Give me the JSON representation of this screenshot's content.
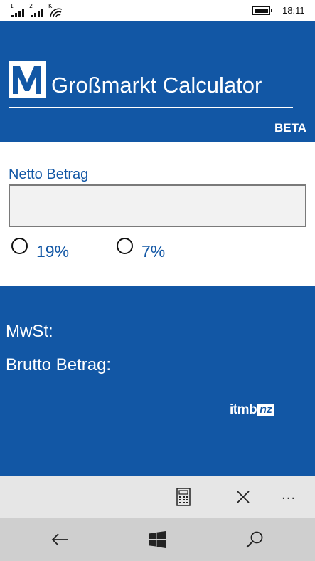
{
  "status_bar": {
    "sim1": "1",
    "sim2": "2",
    "wifi_marker": "K",
    "time": "18:11",
    "icons": [
      "signal-icon",
      "signal-icon",
      "wifi-icon",
      "battery-icon"
    ]
  },
  "header": {
    "title": "Großmarkt Calculator",
    "badge": "BETA",
    "logo_icon": "m-logo-icon",
    "background": "#1257a5"
  },
  "form": {
    "netto_label": "Netto Betrag",
    "netto_value": "",
    "vat_options": [
      {
        "label": "19%",
        "selected": false
      },
      {
        "label": "7%",
        "selected": false
      }
    ]
  },
  "results": {
    "mwst_label": "MwSt:",
    "brutto_label": "Brutto Betrag:",
    "brand_text": "itmb",
    "brand_badge": "nz"
  },
  "app_bar": {
    "buttons": [
      "calculator-icon",
      "close-icon"
    ],
    "more": "..."
  },
  "nav_bar": {
    "buttons": [
      "back-arrow-icon",
      "windows-icon",
      "search-icon"
    ]
  }
}
